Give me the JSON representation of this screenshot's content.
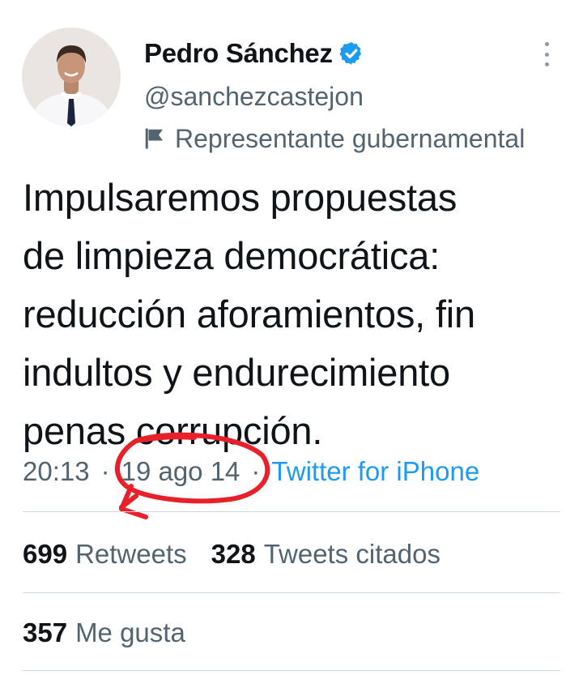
{
  "author": {
    "name": "Pedro Sánchez",
    "handle": "@sanchezcastejon",
    "account_label": "Representante gubernamental",
    "verified_icon": "verified-badge",
    "label_icon": "flag-icon"
  },
  "tweet": {
    "text": "Impulsaremos propuestas\nde limpieza democrática:\nreducción aforamientos, fin\nindultos y endurecimiento\npenas corrupción."
  },
  "meta": {
    "time": "20:13",
    "separator": "·",
    "date": "19 ago 14",
    "source": "Twitter for iPhone"
  },
  "stats": {
    "retweets_count": "699",
    "retweets_label": "Retweets",
    "quotes_count": "328",
    "quotes_label": "Tweets citados",
    "likes_count": "357",
    "likes_label": "Me gusta"
  },
  "colors": {
    "text_primary": "#0f1419",
    "text_secondary": "#536471",
    "link": "#1d9bf0",
    "annotation": "#e8202a",
    "divider": "#cfd9de"
  }
}
